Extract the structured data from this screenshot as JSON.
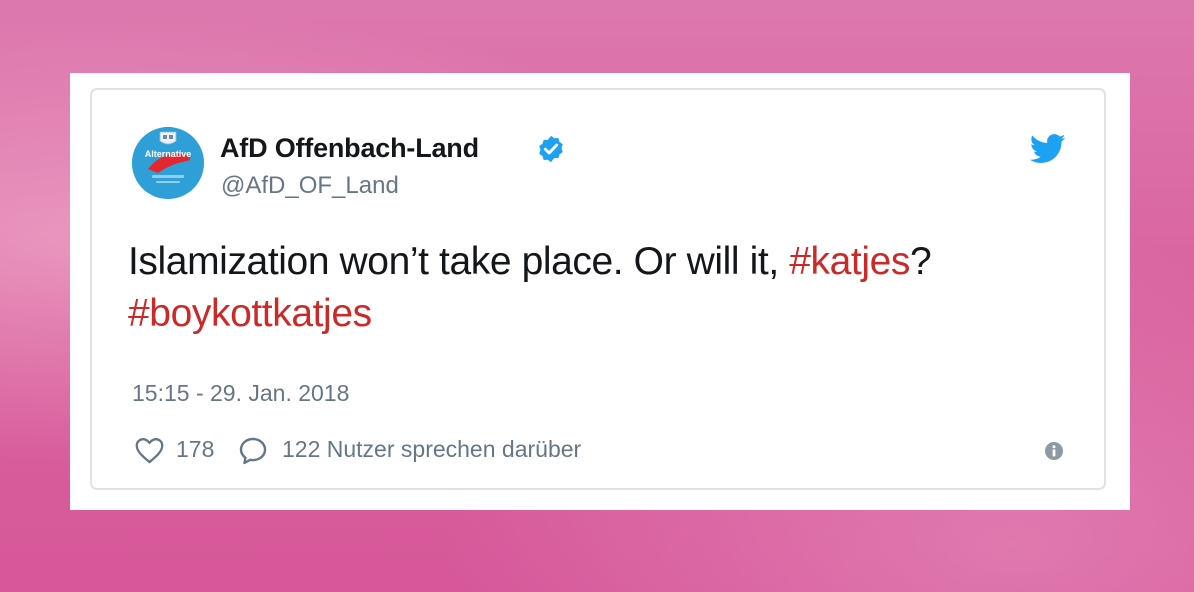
{
  "author": {
    "display_name": "AfD Offenbach-Land",
    "handle": "@AfD_OF_Land",
    "verified": true,
    "avatar_text": "Alternative"
  },
  "tweet": {
    "text_main": "Islamization won’t take place. Or will it, ",
    "hashtag1": "#katjes",
    "text_after": "?",
    "hashtag2": "#boykottkatjes",
    "timestamp": "15:15 - 29. Jan. 2018"
  },
  "stats": {
    "likes": "178",
    "replies_text": "122 Nutzer sprechen darüber"
  },
  "icons": {
    "bird": "twitter-bird-icon",
    "verified": "verified-badge-icon",
    "heart": "heart-icon",
    "reply": "reply-bubble-icon",
    "info": "info-icon"
  },
  "colors": {
    "hashtag": "#cb2a2a",
    "twitter_blue": "#1da1f2",
    "muted": "#657786",
    "background_pink": "#d9619d"
  }
}
